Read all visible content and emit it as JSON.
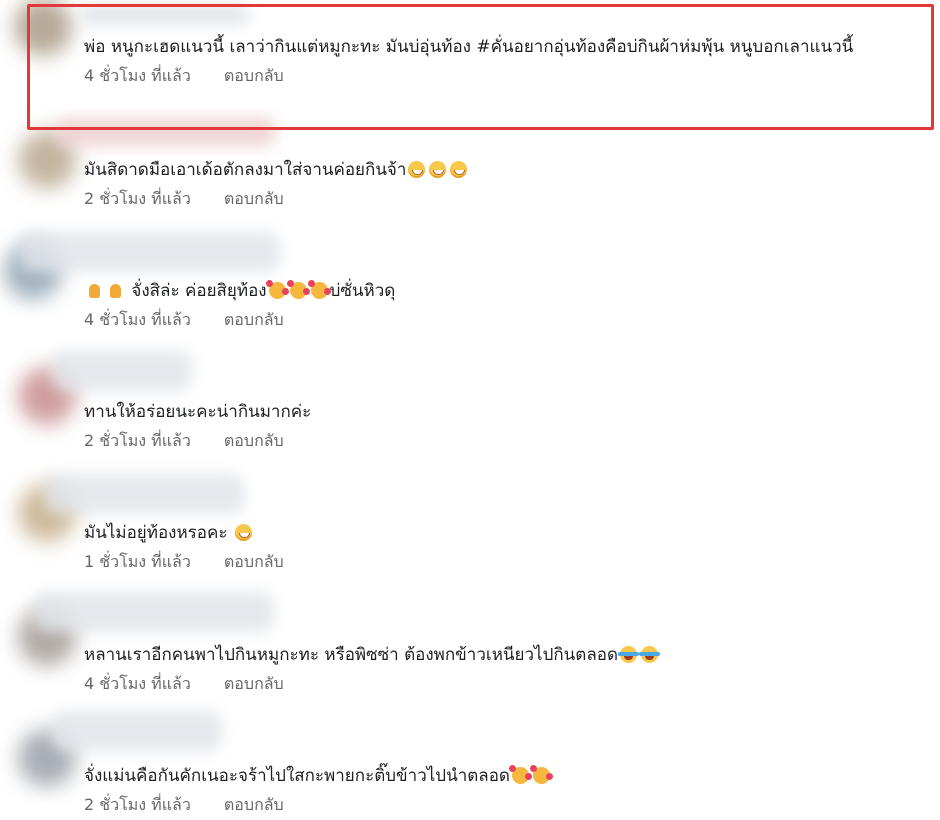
{
  "time_suffix": "ที่แล้ว",
  "reply_label": "ตอบกลับ",
  "comments": [
    {
      "text_parts": [
        "พ่อ หนูกะเฮดแนวนี้ เลาว่ากินแต่หมูกะทะ มันบ่อุ่นท้อง #คั่นอยากอุ่นท้องคือบ่กินผ้าห่มพุ้น หนูบอกเลาแนวนี้"
      ],
      "time": "4 ชั่วโมง",
      "avatar_color": "#a99b86"
    },
    {
      "text_parts": [
        "มันสิดาดมือเอาเด้อตักลงมาใส่จานค่อยกินจ้า"
      ],
      "emojis": [
        "grinning-face",
        "grinning-face",
        "grinning-face"
      ],
      "time": "2 ชั่วโมง",
      "avatar_color": "#b9a890"
    },
    {
      "pre_emojis": [
        "thumbs-up",
        "thumbs-up"
      ],
      "text_parts": [
        "จั่งสิล่ะ ค่อยสิยุท้อง"
      ],
      "emojis": [
        "smiling-face-with-hearts",
        "smiling-face-with-hearts",
        "smiling-face-with-hearts"
      ],
      "tail": "บ่ซั่นหิวดุ",
      "time": "4 ชั่วโมง",
      "avatar_color": "#8fa3b2"
    },
    {
      "text_parts": [
        "ทานให้อร่อยนะคะน่ากินมากค่ะ"
      ],
      "time": "2 ชั่วโมง",
      "avatar_color": "#c88e8e"
    },
    {
      "text_parts": [
        "มันไม่อยู่ท้องหรอคะ"
      ],
      "emojis": [
        "grinning-face"
      ],
      "time": "1 ชั่วโมง",
      "avatar_color": "#c6ae8a"
    },
    {
      "text_parts": [
        "หลานเราอีกคนพาไปกินหมูกะทะ หรือพิซซ่า ต้องพกข้าวเหนียวไปกินตลอด"
      ],
      "emojis": [
        "face-with-tears-of-joy",
        "face-with-tears-of-joy"
      ],
      "time": "4 ชั่วโมง",
      "avatar_color": "#a39a94"
    },
    {
      "text_parts": [
        "จั่งแม่นคือกันคักเนอะจร้าไปใสกะพายกะติ๊บข้าวไปนำตลอด"
      ],
      "emojis": [
        "smiling-face-with-hearts",
        "smiling-face-with-hearts"
      ],
      "time": "2 ชั่วโมง",
      "avatar_color": "#9aa0a8"
    }
  ]
}
